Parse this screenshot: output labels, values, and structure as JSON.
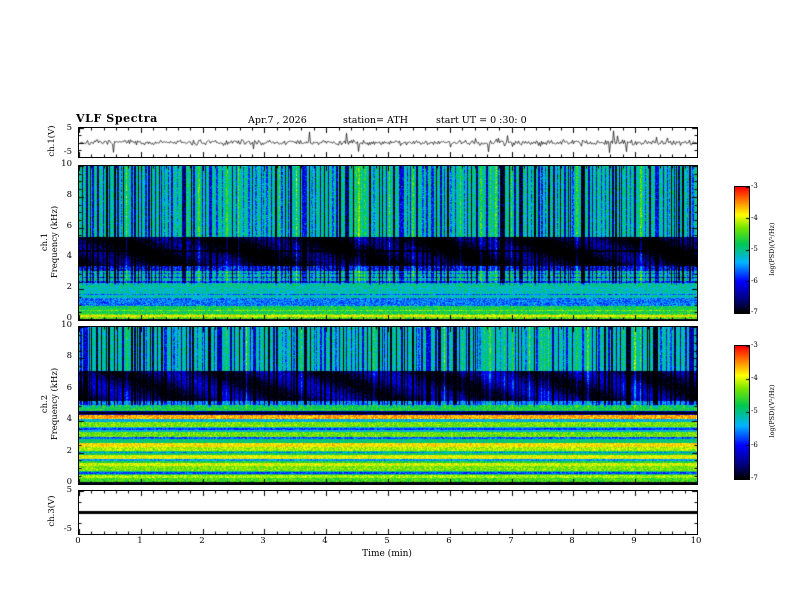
{
  "header": {
    "title": "VLF Spectra",
    "date": "Apr.7 , 2026",
    "station": "station= ATH",
    "start_ut": "start UT =  0 :30: 0"
  },
  "left_axis": {
    "ch1_wave_label": "ch.1(V)",
    "ch3_wave_label": "ch.3(V)",
    "ch1_spec_channel": "ch.1",
    "ch1_spec_axis": "Frequency (kHz)",
    "ch2_spec_channel": "ch.2",
    "ch2_spec_axis": "Frequency (kHz)",
    "wave_ymax": "5",
    "wave_ymin": "-5",
    "freq_ticks": [
      "10",
      "8",
      "6",
      "4",
      "2",
      "0"
    ]
  },
  "xaxis": {
    "label": "Time (min)",
    "ticks": [
      "0",
      "1",
      "2",
      "3",
      "4",
      "5",
      "6",
      "7",
      "8",
      "9",
      "10"
    ]
  },
  "colorbar": {
    "label": "log(PSD)(V²/Hz)",
    "ticks": [
      "-3",
      "-4",
      "-5",
      "-6",
      "-7"
    ],
    "colormap_stops": [
      {
        "t": 0.0,
        "c": "#000000"
      },
      {
        "t": 0.1,
        "c": "#000078"
      },
      {
        "t": 0.25,
        "c": "#0000ff"
      },
      {
        "t": 0.4,
        "c": "#00b4ff"
      },
      {
        "t": 0.55,
        "c": "#00c850"
      },
      {
        "t": 0.68,
        "c": "#78e600"
      },
      {
        "t": 0.78,
        "c": "#ffff00"
      },
      {
        "t": 0.88,
        "c": "#ff8c00"
      },
      {
        "t": 1.0,
        "c": "#ff0000"
      }
    ]
  },
  "chart_data": [
    {
      "type": "line",
      "name": "ch.1 voltage waveform",
      "xlabel": "Time (min)",
      "xlim": [
        0,
        10
      ],
      "ylabel": "ch.1(V)",
      "ylim": [
        -5,
        5
      ],
      "description": "continuous noisy trace centred on 0 V, background about plus/minus 1 V, frequent impulsive spikes reaching plus/minus 5 V"
    },
    {
      "type": "heatmap",
      "name": "ch.1 VLF spectrogram",
      "xlabel": "Time (min)",
      "xlim": [
        0,
        10
      ],
      "ylabel": "Frequency (kHz)",
      "ylim": [
        0,
        10
      ],
      "colorbar_label": "log(PSD)(V²/Hz)",
      "value_range_log_psd": [
        -7,
        -3
      ],
      "bands": [
        {
          "f": [
            0,
            0.12
          ],
          "log_psd": -7.0
        },
        {
          "f": [
            0.12,
            0.45
          ],
          "log_psd": -4.4
        },
        {
          "f": [
            0.45,
            0.95
          ],
          "log_psd": -4.75
        },
        {
          "f": [
            0.95,
            1.45
          ],
          "log_psd": -5.6
        },
        {
          "f": [
            1.45,
            2.2
          ],
          "log_psd": -5.15
        },
        {
          "f": [
            2.2,
            3.2
          ],
          "log_psd": -5.0
        },
        {
          "f": [
            3.2,
            3.55
          ],
          "log_psd": -5.9
        },
        {
          "f": [
            3.55,
            5.4
          ],
          "log_psd": -6.4
        },
        {
          "f": [
            5.4,
            10.01
          ],
          "log_psd": -5.05
        }
      ],
      "lines": [
        {
          "f": 2.5,
          "delta": -0.8
        },
        {
          "f": 2.8,
          "delta": -0.7
        },
        {
          "f": 3.05,
          "delta": -0.6
        },
        {
          "f": 4.5,
          "delta": -0.5
        },
        {
          "f": 1.7,
          "delta": -0.5
        },
        {
          "f": 0.3,
          "delta": 0.5
        },
        {
          "f": 0.65,
          "delta": 0.4
        }
      ],
      "vertical_streaks": {
        "description": "dense dark-blue impulsive sferic streaks above ~2.2 kHz",
        "min_freq_khz": 2.2,
        "approx_count": 120,
        "log_psd_delta_range": [
          -0.5,
          -2.2
        ]
      },
      "dark_patch_band_khz": [
        3.55,
        5.4
      ]
    },
    {
      "type": "heatmap",
      "name": "ch.2 VLF spectrogram",
      "xlabel": "Time (min)",
      "xlim": [
        0,
        10
      ],
      "ylabel": "Frequency (kHz)",
      "ylim": [
        0,
        10
      ],
      "colorbar_label": "log(PSD)(V²/Hz)",
      "value_range_log_psd": [
        -7,
        -3
      ],
      "bands": [
        {
          "f": [
            0,
            0.15
          ],
          "log_psd": -7.0
        },
        {
          "f": [
            0.15,
            0.4
          ],
          "log_psd": -4.5
        },
        {
          "f": [
            0.4,
            0.62
          ],
          "log_psd": -4.15
        },
        {
          "f": [
            0.62,
            0.85
          ],
          "log_psd": -4.9
        },
        {
          "f": [
            0.85,
            1.15
          ],
          "log_psd": -4.3
        },
        {
          "f": [
            1.15,
            1.4
          ],
          "log_psd": -4.0
        },
        {
          "f": [
            1.4,
            1.65
          ],
          "log_psd": -4.65
        },
        {
          "f": [
            1.65,
            1.9
          ],
          "log_psd": -3.95
        },
        {
          "f": [
            1.9,
            2.15
          ],
          "log_psd": -4.8
        },
        {
          "f": [
            2.15,
            2.4
          ],
          "log_psd": -4.15
        },
        {
          "f": [
            2.4,
            2.62
          ],
          "log_psd": -3.8
        },
        {
          "f": [
            2.62,
            3.05
          ],
          "log_psd": -4.9
        },
        {
          "f": [
            3.05,
            3.35
          ],
          "log_psd": -4.35
        },
        {
          "f": [
            3.35,
            3.65
          ],
          "log_psd": -5.2
        },
        {
          "f": [
            3.65,
            3.95
          ],
          "log_psd": -4.3
        },
        {
          "f": [
            3.95,
            4.18
          ],
          "log_psd": -5.3
        },
        {
          "f": [
            4.18,
            4.4
          ],
          "log_psd": -3.6
        },
        {
          "f": [
            4.4,
            4.65
          ],
          "log_psd": -6.3
        },
        {
          "f": [
            4.65,
            5.05
          ],
          "log_psd": -4.7
        },
        {
          "f": [
            5.05,
            5.35
          ],
          "log_psd": -5.5
        },
        {
          "f": [
            5.35,
            7.2
          ],
          "log_psd": -6.15
        },
        {
          "f": [
            7.2,
            10.01
          ],
          "log_psd": -5.1
        }
      ],
      "lines": [
        {
          "f": 0.75,
          "delta": -0.9
        },
        {
          "f": 1.55,
          "delta": -0.8
        },
        {
          "f": 2.05,
          "delta": -0.7
        },
        {
          "f": 2.95,
          "delta": -0.8
        },
        {
          "f": 3.55,
          "delta": -0.6
        },
        {
          "f": 4.55,
          "delta": -0.8
        }
      ],
      "vertical_streaks": {
        "description": "dense dark-blue impulsive sferic streaks above ~4.8 kHz",
        "min_freq_khz": 4.8,
        "approx_count": 120,
        "log_psd_delta_range": [
          -0.5,
          -2.2
        ]
      },
      "dark_patch_band_khz": [
        5.35,
        7.2
      ]
    },
    {
      "type": "line",
      "name": "ch.3 voltage waveform",
      "xlabel": "Time (min)",
      "xlim": [
        0,
        10
      ],
      "ylabel": "ch.3(V)",
      "ylim": [
        -5,
        5
      ],
      "description": "flat constant line at 0 V (no signal)"
    }
  ]
}
